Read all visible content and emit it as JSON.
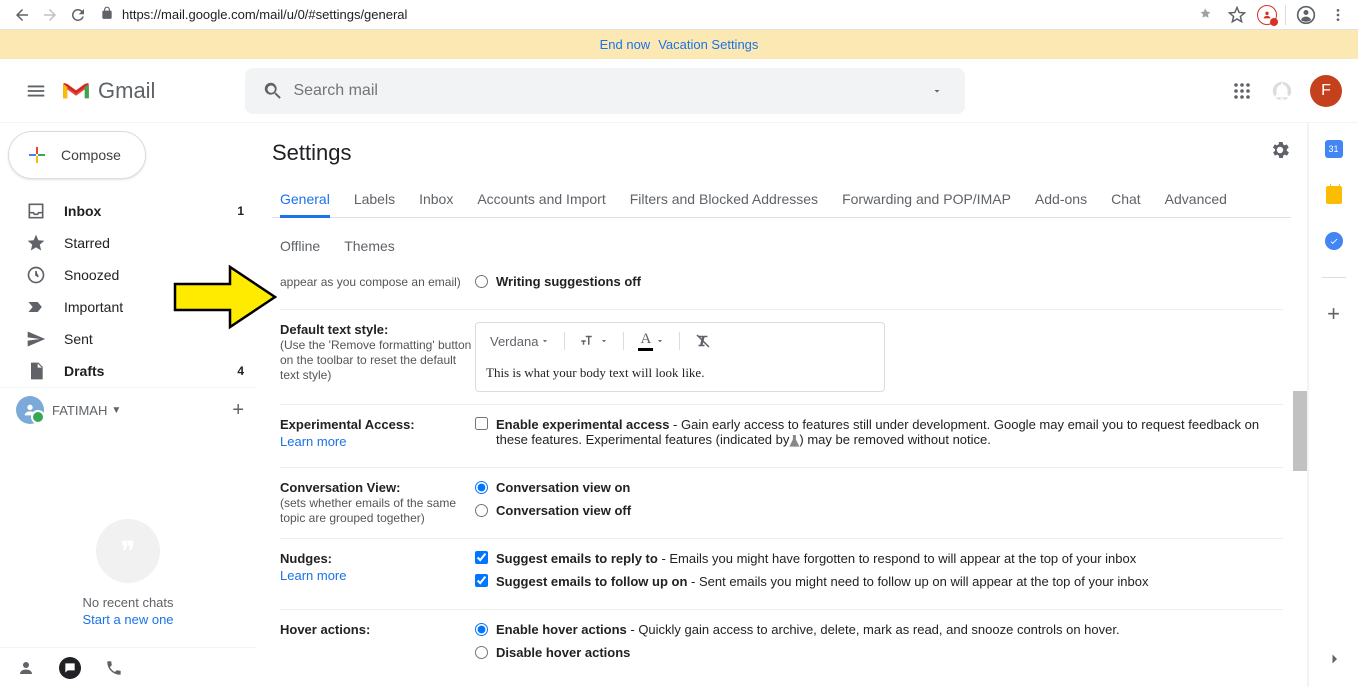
{
  "browser": {
    "url": "https://mail.google.com/mail/u/0/#settings/general"
  },
  "vacation": {
    "end_now": "End now",
    "settings": "Vacation Settings"
  },
  "header": {
    "logo": "Gmail",
    "search_placeholder": "Search mail",
    "avatar_letter": "F"
  },
  "sidebar": {
    "compose": "Compose",
    "items": [
      {
        "label": "Inbox",
        "count": "1"
      },
      {
        "label": "Starred"
      },
      {
        "label": "Snoozed"
      },
      {
        "label": "Important"
      },
      {
        "label": "Sent"
      },
      {
        "label": "Drafts",
        "count": "4"
      }
    ],
    "user": "FATIMAH",
    "no_chats": "No recent chats",
    "start_chat": "Start a new one"
  },
  "settings": {
    "title": "Settings",
    "tabs1": [
      "General",
      "Labels",
      "Inbox",
      "Accounts and Import",
      "Filters and Blocked Addresses",
      "Forwarding and POP/IMAP",
      "Add-ons",
      "Chat",
      "Advanced"
    ],
    "tabs2": [
      "Offline",
      "Themes"
    ],
    "partial_top": {
      "sub": "appear as you compose an email)",
      "option": "Writing suggestions off"
    },
    "text_style": {
      "title": "Default text style:",
      "sub": "(Use the 'Remove formatting' button on the toolbar to reset the default text style)",
      "font": "Verdana",
      "preview": "This is what your body text will look like."
    },
    "experimental": {
      "title": "Experimental Access:",
      "learn": "Learn more",
      "bold": "Enable experimental access",
      "desc1": " - Gain early access to features still under development. Google may email you to request feedback on these features. Experimental features (indicated by",
      "desc2": ") may be removed without notice."
    },
    "conversation": {
      "title": "Conversation View:",
      "sub": "(sets whether emails of the same topic are grouped together)",
      "on": "Conversation view on",
      "off": "Conversation view off"
    },
    "nudges": {
      "title": "Nudges:",
      "learn": "Learn more",
      "reply_b": "Suggest emails to reply to",
      "reply_d": " - Emails you might have forgotten to respond to will appear at the top of your inbox",
      "follow_b": "Suggest emails to follow up on",
      "follow_d": " - Sent emails you might need to follow up on will appear at the top of your inbox"
    },
    "hover": {
      "title": "Hover actions:",
      "enable_b": "Enable hover actions",
      "enable_d": " - Quickly gain access to archive, delete, mark as read, and snooze controls on hover.",
      "disable": "Disable hover actions"
    }
  },
  "rail": {
    "cal_day": "31"
  }
}
